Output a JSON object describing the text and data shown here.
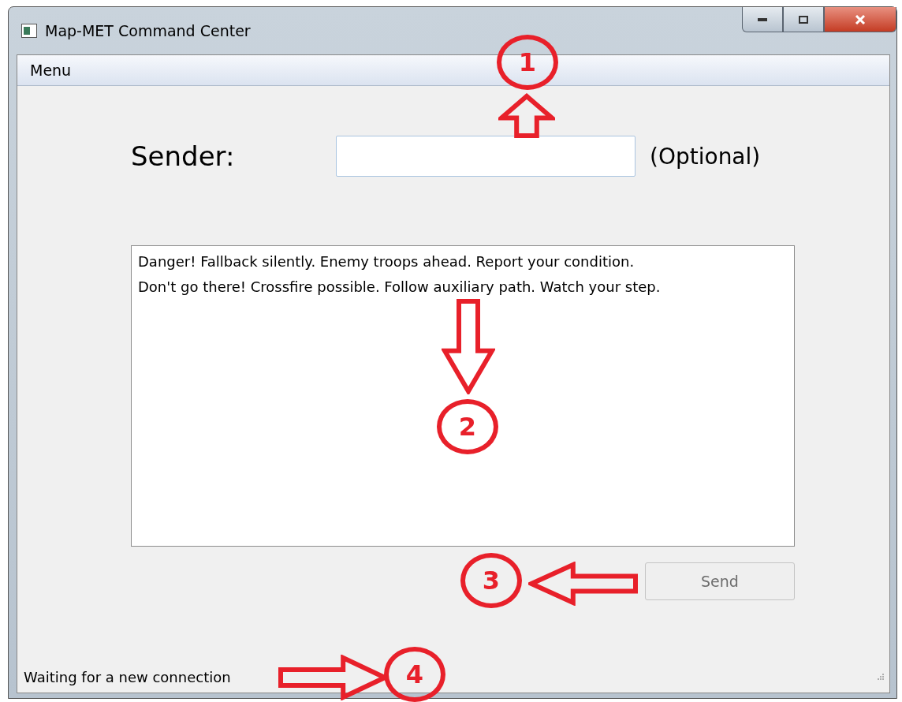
{
  "window": {
    "title": "Map-MET Command Center"
  },
  "menu_bar": {
    "items": [
      "Menu"
    ]
  },
  "sender": {
    "label": "Sender:",
    "note": "(Optional)"
  },
  "message": {
    "value": "Danger! Fallback silently. Enemy troops ahead. Report your condition.\nDon't go there! Crossfire possible. Follow auxiliary path. Watch your step."
  },
  "send_button": {
    "label": "Send",
    "disabled": true
  },
  "status_bar": {
    "text": "Waiting for a new connection"
  },
  "annotations": [
    {
      "number": "1",
      "kind": "up"
    },
    {
      "number": "2",
      "kind": "down"
    },
    {
      "number": "3",
      "kind": "left"
    },
    {
      "number": "4",
      "kind": "right"
    }
  ]
}
